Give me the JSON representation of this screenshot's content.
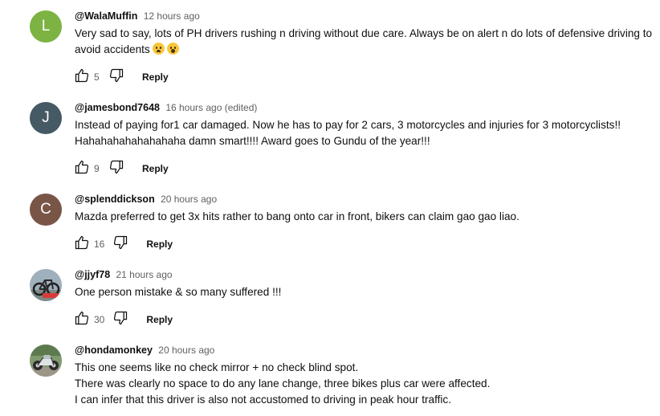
{
  "comments": [
    {
      "avatar_letter": "L",
      "avatar_color": "#7cb342",
      "author": "@WalaMuffin",
      "time": "12 hours ago",
      "text": "Very sad to say, lots of PH drivers rushing n driving without due care. Always be on alert n do lots of defensive driving to avoid accidents",
      "emojis": [
        "worried-face-emoji",
        "astonished-face-emoji"
      ],
      "likes": "5",
      "reply_label": "Reply"
    },
    {
      "avatar_letter": "J",
      "avatar_color": "#455a64",
      "author": "@jamesbond7648",
      "time": "16 hours ago (edited)",
      "text": "Instead of paying for1 car damaged. Now he has to pay for 2 cars, 3 motorcycles and injuries for 3 motorcyclists!! Hahahahahahahahaha damn smart!!!! Award goes to Gundu of the year!!!",
      "likes": "9",
      "reply_label": "Reply"
    },
    {
      "avatar_letter": "C",
      "avatar_color": "#795548",
      "author": "@splenddickson",
      "time": "20 hours ago",
      "text": "Mazda preferred to get 3x hits rather to bang onto car in front, bikers can claim gao gao liao.",
      "likes": "16",
      "reply_label": "Reply"
    },
    {
      "avatar_icon": "bicycle-photo-avatar",
      "author": "@jjyf78",
      "time": "21 hours ago",
      "text": "One person mistake & so many suffered !!!",
      "likes": "30",
      "reply_label": "Reply"
    },
    {
      "avatar_icon": "motorcycle-photo-avatar",
      "author": "@hondamonkey",
      "time": "20 hours ago",
      "text": "This one seems like no check mirror + no check blind spot.\nThere was clearly no space to do any lane change, three bikes plus car were affected.\nI can infer that this driver is also not accustomed to driving in peak hour traffic."
    }
  ]
}
